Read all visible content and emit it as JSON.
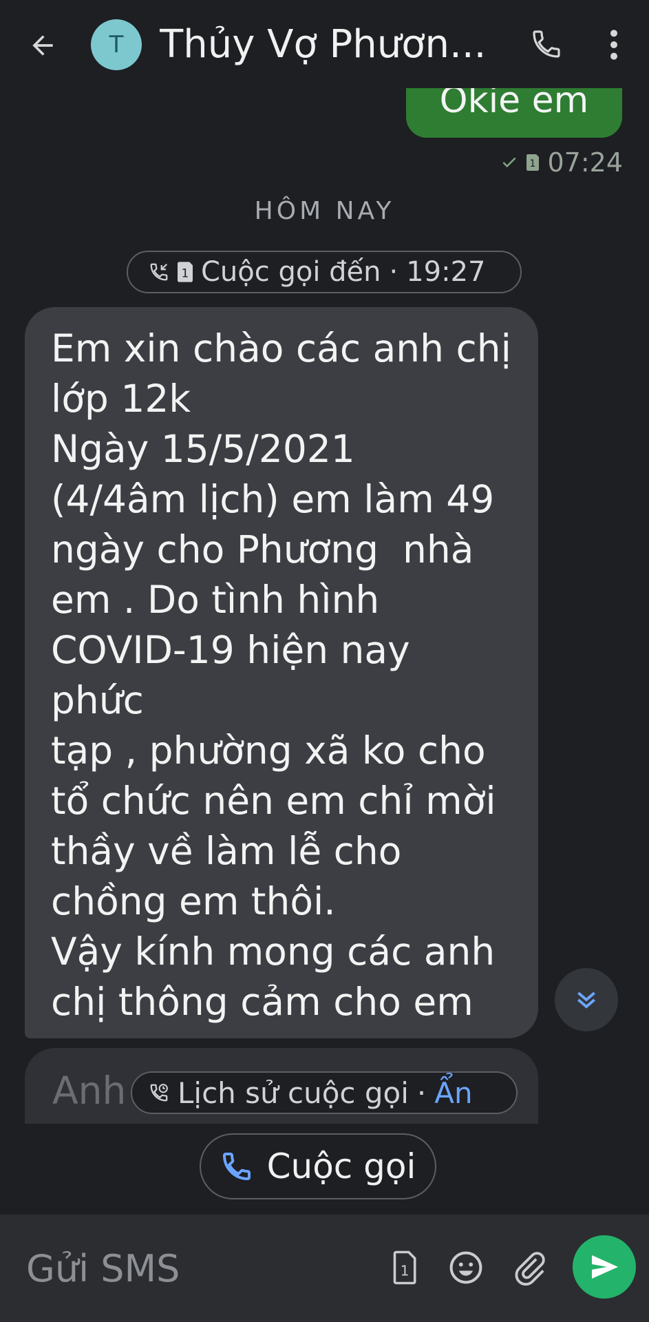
{
  "header": {
    "avatar_letter": "T",
    "title": "Thủy Vợ Phươn..."
  },
  "sent_message": {
    "text": "Okie em",
    "time": "07:24",
    "sim": "1"
  },
  "date_separator": "HÔM NAY",
  "incoming_call": {
    "sim": "1",
    "label": "Cuộc gọi đến",
    "separator": "·",
    "time": "19:27"
  },
  "received_message": {
    "text": "Em xin chào các anh chị\nlớp 12k\nNgày 15/5/2021\n(4/4âm lịch) em làm 49\nngày cho Phương  nhà\nem . Do tình hình\nCOVID-19 hiện nay phức\ntạp , phường xã ko cho\ntổ chức nên em chỉ mời\nthầy về làm lễ cho\nchồng em thôi.\nVậy kính mong các anh\nchị thông cảm cho em"
  },
  "next_message_preview": "Anh",
  "call_history_chip": {
    "label": "Lịch sử cuộc gọi",
    "separator": "·",
    "hide": "Ẩn"
  },
  "call_button_label": "Cuộc gọi",
  "composer": {
    "placeholder": "Gửi SMS",
    "sim": "1"
  },
  "colors": {
    "background": "#1d1f23",
    "sent_bubble": "#2e7d32",
    "received_bubble": "#3c3e43",
    "accent_link": "#6ca4ff",
    "send_button": "#24b36b",
    "avatar": "#7dc8cf"
  },
  "icons": [
    "back-arrow-icon",
    "phone-icon",
    "more-vert-icon",
    "check-icon",
    "sim-card-icon",
    "incoming-call-icon",
    "call-history-icon",
    "double-chevron-down-icon",
    "call-icon",
    "sim-select-icon",
    "emoji-icon",
    "attach-icon",
    "send-icon"
  ]
}
